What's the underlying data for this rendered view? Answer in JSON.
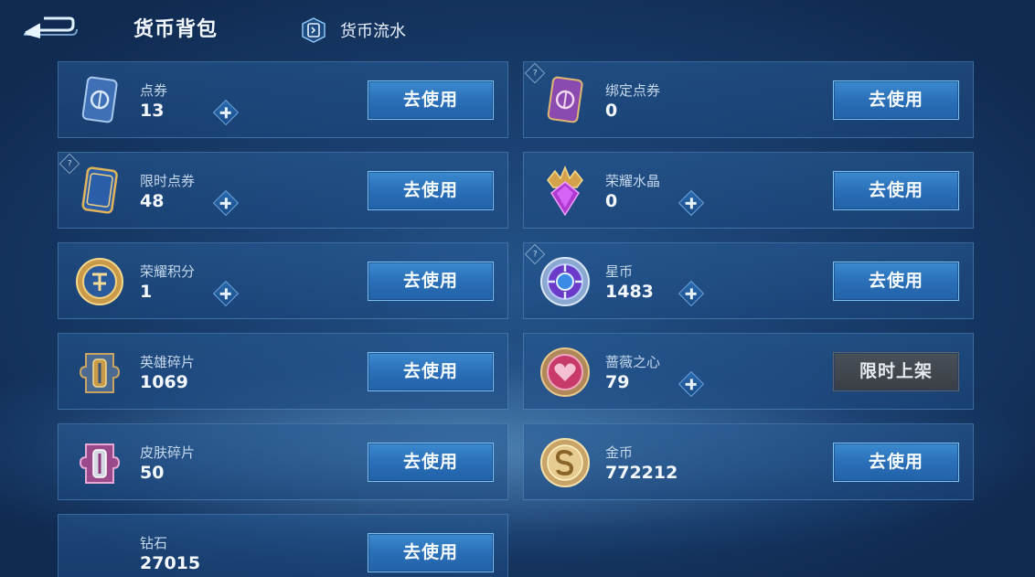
{
  "header": {
    "title": "货币背包",
    "flow_label": "货币流水"
  },
  "colors": {
    "button_blue": "#2a6fb8",
    "button_border": "#7cc1f5",
    "disabled_button": "#3a3f46",
    "card_bg": "#1c4880"
  },
  "currencies": [
    {
      "name": "点券",
      "amount": "13",
      "action": "去使用",
      "icon": "voucher-blue-icon",
      "plus": true,
      "help": false
    },
    {
      "name": "绑定点券",
      "amount": "0",
      "action": "去使用",
      "icon": "bound-voucher-purple-icon",
      "plus": false,
      "help": true
    },
    {
      "name": "限时点券",
      "amount": "48",
      "action": "去使用",
      "icon": "limited-voucher-icon",
      "plus": true,
      "help": true
    },
    {
      "name": "荣耀水晶",
      "amount": "0",
      "action": "去使用",
      "icon": "glory-crystal-icon",
      "plus": true,
      "help": false
    },
    {
      "name": "荣耀积分",
      "amount": "1",
      "action": "去使用",
      "icon": "glory-points-coin-icon",
      "plus": true,
      "help": false
    },
    {
      "name": "星币",
      "amount": "1483",
      "action": "去使用",
      "icon": "star-coin-icon",
      "plus": true,
      "help": true
    },
    {
      "name": "英雄碎片",
      "amount": "1069",
      "action": "去使用",
      "icon": "hero-fragment-icon",
      "plus": false,
      "help": false
    },
    {
      "name": "蔷薇之心",
      "amount": "79",
      "action": "限时上架",
      "icon": "rose-heart-icon",
      "plus": true,
      "help": false,
      "disabled": true
    },
    {
      "name": "皮肤碎片",
      "amount": "50",
      "action": "去使用",
      "icon": "skin-fragment-icon",
      "plus": false,
      "help": false
    },
    {
      "name": "金币",
      "amount": "772212",
      "action": "去使用",
      "icon": "gold-coin-icon",
      "plus": false,
      "help": false
    },
    {
      "name": "钻石",
      "amount": "27015",
      "action": "去使用",
      "icon": "diamond-icon",
      "plus": false,
      "help": false
    }
  ]
}
